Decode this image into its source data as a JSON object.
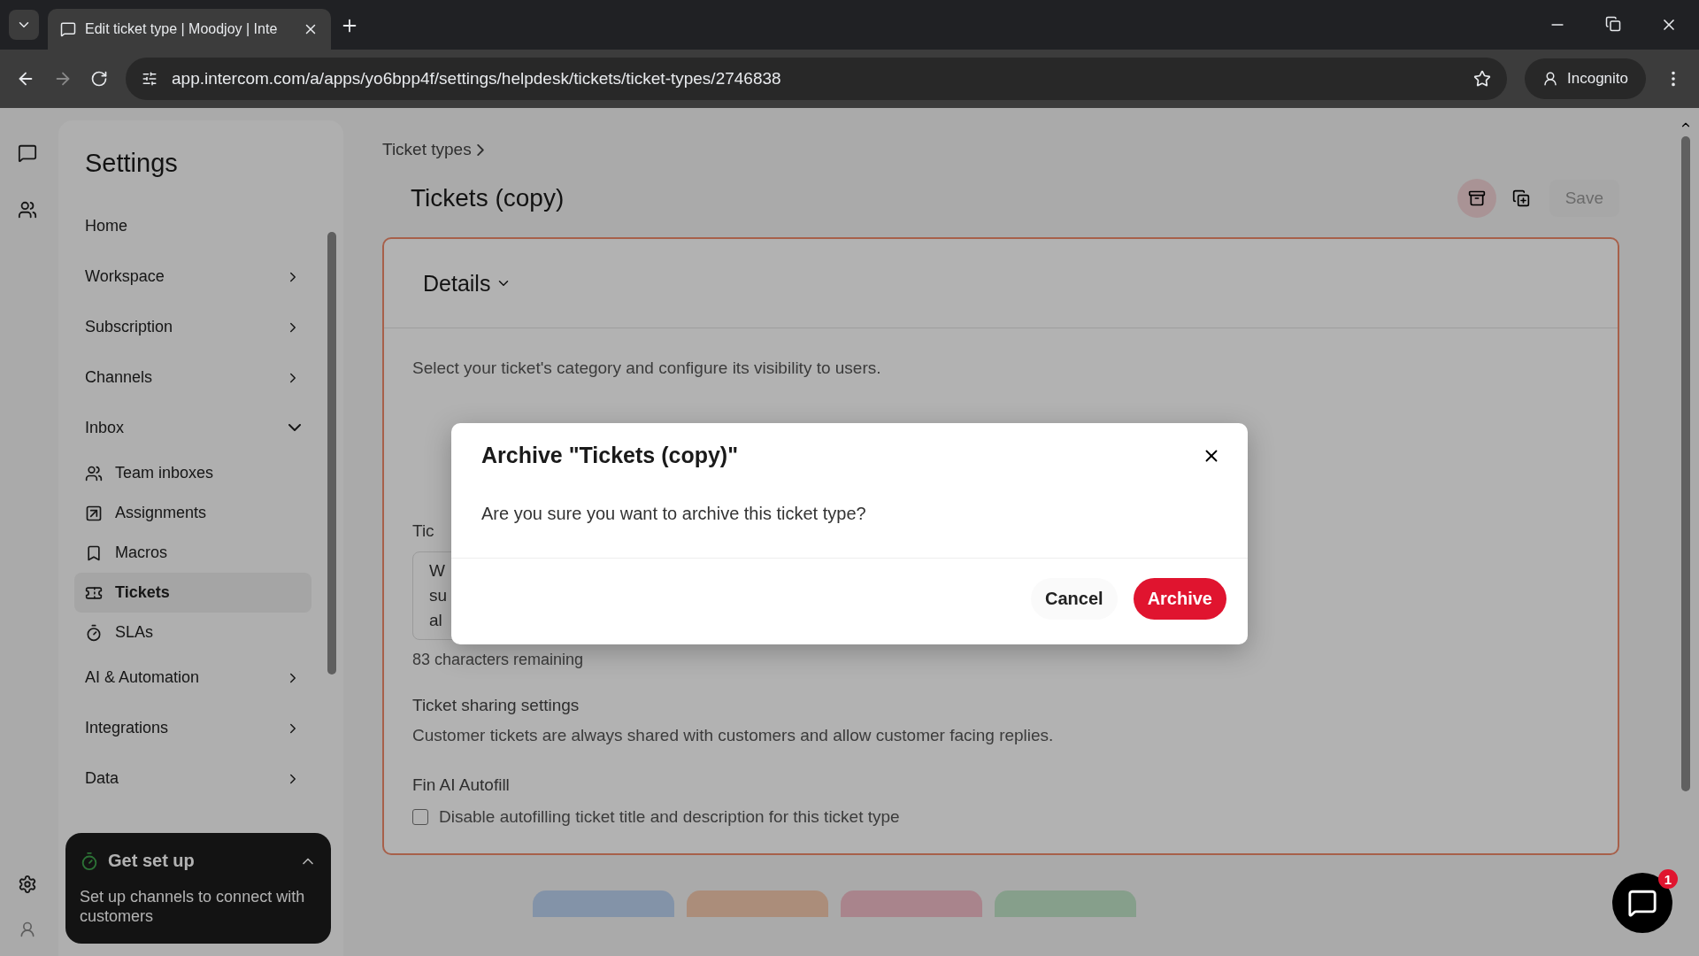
{
  "browser": {
    "tab_title": "Edit ticket type | Moodjoy | Inte",
    "url": "app.intercom.com/a/apps/yo6bpp4f/settings/helpdesk/tickets/ticket-types/2746838",
    "profile": "Incognito"
  },
  "sidebar": {
    "title": "Settings",
    "items": [
      {
        "label": "Home",
        "kind": "link"
      },
      {
        "label": "Workspace",
        "kind": "group",
        "expanded": false
      },
      {
        "label": "Subscription",
        "kind": "group",
        "expanded": false
      },
      {
        "label": "Channels",
        "kind": "group",
        "expanded": false
      },
      {
        "label": "Inbox",
        "kind": "group",
        "expanded": true,
        "children": [
          {
            "label": "Team inboxes",
            "selected": false
          },
          {
            "label": "Assignments",
            "selected": false
          },
          {
            "label": "Macros",
            "selected": false
          },
          {
            "label": "Tickets",
            "selected": true
          },
          {
            "label": "SLAs",
            "selected": false
          }
        ]
      },
      {
        "label": "AI & Automation",
        "kind": "group",
        "expanded": false
      },
      {
        "label": "Integrations",
        "kind": "group",
        "expanded": false
      },
      {
        "label": "Data",
        "kind": "group",
        "expanded": false
      }
    ],
    "setup": {
      "title": "Get set up",
      "text": "Set up channels to connect with customers"
    }
  },
  "main": {
    "breadcrumb": "Ticket types",
    "title": "Tickets (copy)",
    "save": "Save",
    "section": "Details",
    "intro": "Select your ticket's category and configure its visibility to users.",
    "label_fragments": [
      "Tic"
    ],
    "textarea_fragments": [
      "W",
      "su",
      "al"
    ],
    "remaining": "83 characters remaining",
    "sharing_title": "Ticket sharing settings",
    "sharing_text": "Customer tickets are always shared with customers and allow customer facing replies.",
    "fin_title": "Fin AI Autofill",
    "autofill": {
      "label": "Disable autofilling ticket title and description for this ticket type",
      "checked": false
    },
    "state_pills": [
      {
        "color": "#8393a8"
      },
      {
        "color": "#ab8d7a"
      },
      {
        "color": "#a9848c"
      },
      {
        "color": "#869f8b"
      }
    ]
  },
  "dialog": {
    "title": "Archive \"Tickets (copy)\"",
    "message": "Are you sure you want to archive this ticket type?",
    "cancel": "Cancel",
    "confirm": "Archive"
  },
  "chat_badge": "1"
}
